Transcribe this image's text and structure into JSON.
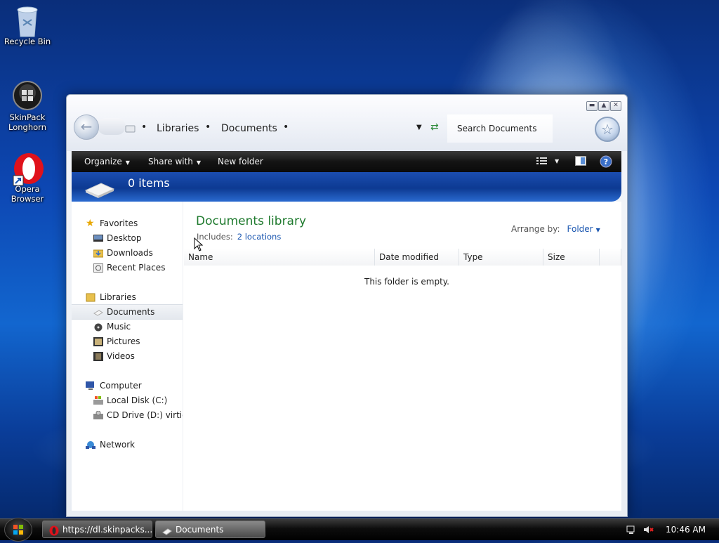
{
  "desktop": {
    "icons": [
      {
        "label_line1": "Recycle Bin",
        "label_line2": ""
      },
      {
        "label_line1": "SkinPack",
        "label_line2": "Longhorn"
      },
      {
        "label_line1": "Opera",
        "label_line2": "Browser"
      }
    ]
  },
  "window": {
    "breadcrumb": [
      "Libraries",
      "Documents"
    ],
    "search_placeholder": "Search Documents",
    "controls": {
      "minimize": "▬",
      "maximize": "▲",
      "close": "✕"
    },
    "toolbar": {
      "organize": "Organize",
      "share_with": "Share with",
      "new_folder": "New folder"
    },
    "banner_text": "0 items",
    "nav": {
      "favorites": "Favorites",
      "desktop": "Desktop",
      "downloads": "Downloads",
      "recent_places": "Recent Places",
      "libraries": "Libraries",
      "documents": "Documents",
      "music": "Music",
      "pictures": "Pictures",
      "videos": "Videos",
      "computer": "Computer",
      "local_disk": "Local Disk (C:)",
      "cd_drive": "CD Drive (D:) virtio-v",
      "network": "Network"
    },
    "library": {
      "title": "Documents library",
      "includes_label": "Includes:",
      "includes_link": "2 locations",
      "arrange_label": "Arrange by:",
      "arrange_value": "Folder"
    },
    "columns": [
      "Name",
      "Date modified",
      "Type",
      "Size"
    ],
    "empty_message": "This folder is empty."
  },
  "taskbar": {
    "tasks": [
      {
        "label": "https://dl.skinpacks...."
      },
      {
        "label": "Documents"
      }
    ],
    "clock": "10:46 AM"
  },
  "colors": {
    "library_title": "#1f7a2e",
    "link": "#1a56b0",
    "toolbar_bg": "#141414",
    "banner_bg": "#0d3a92"
  }
}
